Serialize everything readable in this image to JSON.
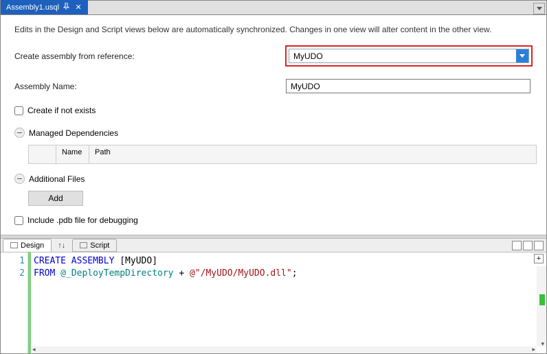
{
  "tab_title": "Assembly1.usql",
  "design_hint": "Edits in the Design and Script views below are automatically synchronized. Changes in one view will alter content in the other view.",
  "form": {
    "ref_label": "Create assembly from reference:",
    "ref_value": "MyUDO",
    "name_label": "Assembly Name:",
    "name_value": "MyUDO",
    "create_if_not_exists_label": "Create if not exists",
    "managed_deps_label": "Managed Dependencies",
    "deps_cols": {
      "name": "Name",
      "path": "Path"
    },
    "additional_files_label": "Additional Files",
    "add_button": "Add",
    "include_pdb_label": "Include .pdb file for debugging"
  },
  "views": {
    "design": "Design",
    "script": "Script"
  },
  "code": {
    "lines": [
      "1",
      "2"
    ],
    "kw_create": "CREATE ASSEMBLY ",
    "ident": "[MyUDO]",
    "kw_from": "FROM ",
    "var": "@_DeployTempDirectory",
    "plus": " + ",
    "str": "@\"/MyUDO/MyUDO.dll\"",
    "semi": ";"
  }
}
